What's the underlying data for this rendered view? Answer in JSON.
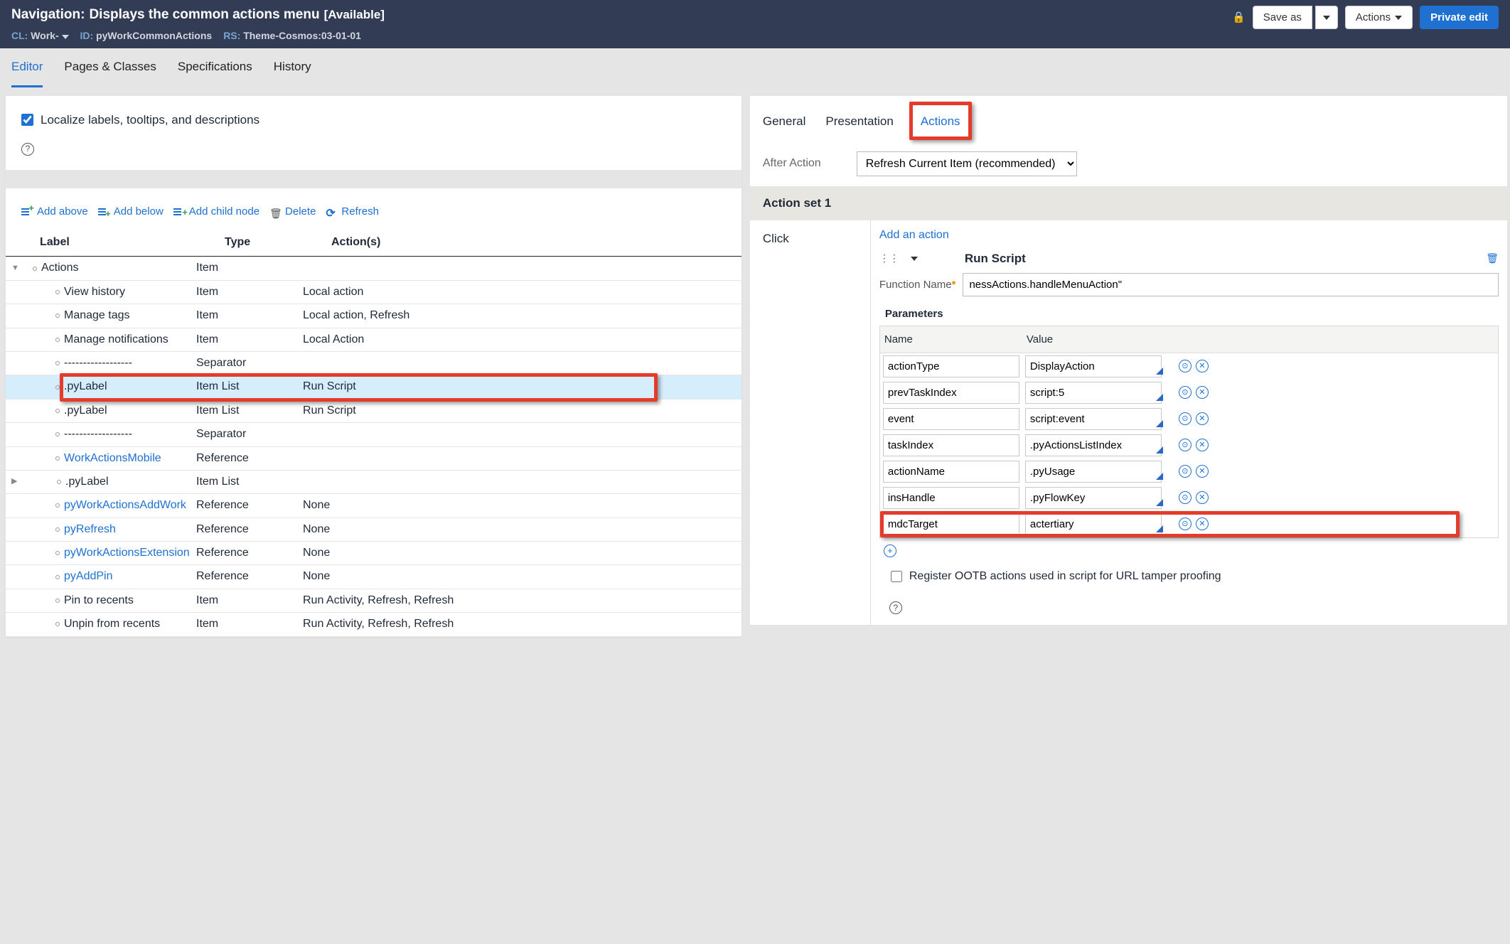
{
  "header": {
    "rule_type": "Navigation:",
    "title": "Displays the common actions menu",
    "availability": "[Available]",
    "cl_label": "CL:",
    "cl_value": "Work-",
    "id_label": "ID:",
    "id_value": "pyWorkCommonActions",
    "rs_label": "RS:",
    "rs_value": "Theme-Cosmos:03-01-01",
    "save_as": "Save as",
    "actions": "Actions",
    "private_edit": "Private edit"
  },
  "main_tabs": {
    "editor": "Editor",
    "pages": "Pages & Classes",
    "specs": "Specifications",
    "history": "History"
  },
  "localize_label": "Localize labels, tooltips, and descriptions",
  "tree_toolbar": {
    "add_above": "Add above",
    "add_below": "Add below",
    "add_child": "Add child node",
    "delete": "Delete",
    "refresh": "Refresh"
  },
  "tree_columns": {
    "label": "Label",
    "type": "Type",
    "actions": "Action(s)"
  },
  "tree_rows": [
    {
      "label": "Actions",
      "type": "Item",
      "actions": "",
      "indent": 1,
      "exp": "down",
      "link": false
    },
    {
      "label": "View history",
      "type": "Item",
      "actions": "Local action",
      "indent": 2,
      "link": false
    },
    {
      "label": "Manage tags",
      "type": "Item",
      "actions": "Local action, Refresh",
      "indent": 2,
      "link": false
    },
    {
      "label": "Manage notifications",
      "type": "Item",
      "actions": "Local Action",
      "indent": 2,
      "link": false
    },
    {
      "label": "------------------",
      "type": "Separator",
      "actions": "",
      "indent": 2,
      "link": false
    },
    {
      "label": ".pyLabel",
      "type": "Item List",
      "actions": "Run Script",
      "indent": 2,
      "link": false,
      "selected": true,
      "highlight": true
    },
    {
      "label": ".pyLabel",
      "type": "Item List",
      "actions": "Run Script",
      "indent": 2,
      "link": false
    },
    {
      "label": "------------------",
      "type": "Separator",
      "actions": "",
      "indent": 2,
      "link": false
    },
    {
      "label": "WorkActionsMobile",
      "type": "Reference",
      "actions": "",
      "indent": 2,
      "link": true
    },
    {
      "label": ".pyLabel",
      "type": "Item List",
      "actions": "",
      "indent": 2,
      "link": false,
      "exp": "right"
    },
    {
      "label": "pyWorkActionsAddWork",
      "type": "Reference",
      "actions": "None",
      "indent": 2,
      "link": true
    },
    {
      "label": "pyRefresh",
      "type": "Reference",
      "actions": "None",
      "indent": 2,
      "link": true
    },
    {
      "label": "pyWorkActionsExtension",
      "type": "Reference",
      "actions": "None",
      "indent": 2,
      "link": true
    },
    {
      "label": "pyAddPin",
      "type": "Reference",
      "actions": "None",
      "indent": 2,
      "link": true
    },
    {
      "label": "Pin to recents",
      "type": "Item",
      "actions": "Run Activity, Refresh, Refresh",
      "indent": 2,
      "link": false
    },
    {
      "label": "Unpin from recents",
      "type": "Item",
      "actions": "Run Activity, Refresh, Refresh",
      "indent": 2,
      "link": false
    }
  ],
  "prop_tabs": {
    "general": "General",
    "presentation": "Presentation",
    "actions": "Actions"
  },
  "after_action": {
    "label": "After Action",
    "selected": "Refresh Current Item (recommended)"
  },
  "action_set": {
    "header": "Action set 1",
    "event": "Click",
    "add_action": "Add an action",
    "action_title": "Run Script",
    "func_label": "Function Name",
    "func_value": "nessActions.handleMenuAction\"",
    "params_header": "Parameters",
    "col_name": "Name",
    "col_value": "Value",
    "params": [
      {
        "name": "actionType",
        "value": "DisplayAction"
      },
      {
        "name": "prevTaskIndex",
        "value": "script:5"
      },
      {
        "name": "event",
        "value": "script:event"
      },
      {
        "name": "taskIndex",
        "value": ".pyActionsListIndex"
      },
      {
        "name": "actionName",
        "value": ".pyUsage"
      },
      {
        "name": "insHandle",
        "value": ".pyFlowKey"
      },
      {
        "name": "mdcTarget",
        "value": "actertiary",
        "highlight": true
      }
    ],
    "register_label": "Register OOTB actions used in script for URL tamper proofing"
  }
}
